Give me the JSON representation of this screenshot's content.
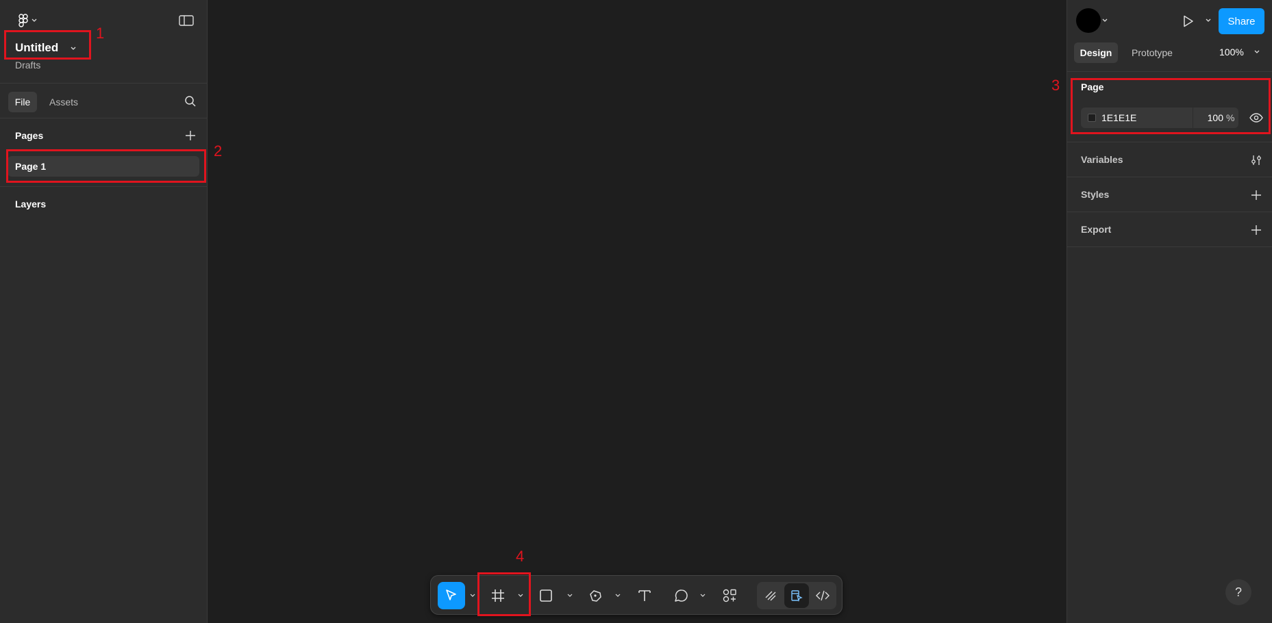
{
  "file": {
    "title": "Untitled",
    "location": "Drafts"
  },
  "left_tabs": [
    "File",
    "Assets"
  ],
  "pages": {
    "heading": "Pages",
    "items": [
      "Page 1"
    ]
  },
  "layers": {
    "heading": "Layers"
  },
  "header": {
    "share_label": "Share"
  },
  "right_tabs": [
    "Design",
    "Prototype"
  ],
  "zoom": "100%",
  "page_panel": {
    "heading": "Page",
    "background_hex": "1E1E1E",
    "opacity_value": "100",
    "opacity_unit": "%"
  },
  "sections": [
    "Variables",
    "Styles",
    "Export"
  ],
  "annotations": [
    "1",
    "2",
    "3",
    "4"
  ],
  "help_label": "?",
  "colors": {
    "accent": "#0d99ff",
    "annotation": "#e0141e",
    "canvas": "#1e1e1e",
    "panel": "#2c2c2c"
  },
  "toolbar": {
    "tools": [
      "move-tool",
      "frame-tool",
      "rectangle-tool",
      "pen-tool",
      "text-tool",
      "comment-tool",
      "actions-tool"
    ],
    "modes": [
      "draw-mode",
      "design-mode",
      "dev-mode"
    ],
    "active_tool": "move-tool",
    "active_mode": "design-mode"
  }
}
